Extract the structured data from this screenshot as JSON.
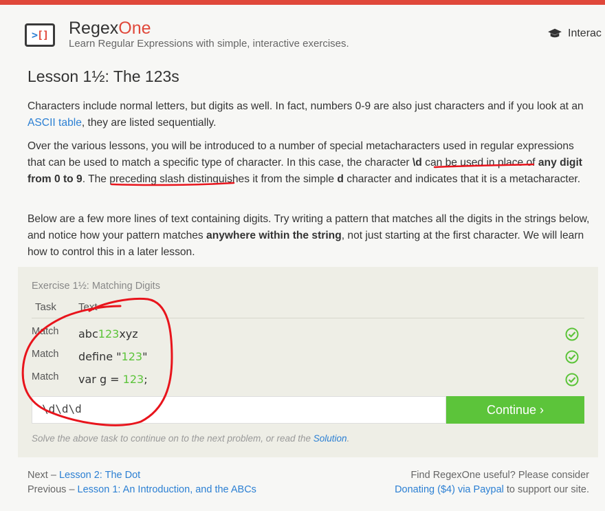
{
  "header": {
    "brand_a": "Regex",
    "brand_b": "One",
    "tagline": "Learn Regular Expressions with simple, interactive exercises.",
    "nav_label": "Interac"
  },
  "lesson": {
    "title": "Lesson 1½: The 123s",
    "p1": {
      "a": "Characters include normal letters, but digits as well. In fact, numbers 0-9 are also just characters and if you look at an ",
      "link": "ASCII table",
      "b": ", they are listed sequentially."
    },
    "p2": {
      "a": "Over the various lessons, you will be introduced to a number of special metacharacters used in regular expressions that can be used to match a specific type of character. In this case, the character ",
      "b1": "\\d",
      "c": " can be used in place of ",
      "b2": "any digit from 0 to 9",
      "d": ". The preceding slash distinguishes it from the simple ",
      "b3": "d",
      "e": " character and indicates that it is a metacharacter."
    },
    "p3": {
      "a": "Below are a few more lines of text containing digits. Try writing a pattern that matches all the digits in the strings below, and notice how your pattern matches ",
      "b": "anywhere within the string",
      "c": ", not just starting at the first character. We will learn how to control this in a later lesson."
    }
  },
  "exercise": {
    "title": "Exercise 1½: Matching Digits",
    "col_task": "Task",
    "col_text": "Text",
    "rows": [
      {
        "task": "Match",
        "pre": "abc",
        "hl": "123",
        "post": "xyz"
      },
      {
        "task": "Match",
        "pre": "define \"",
        "hl": "123",
        "post": "\""
      },
      {
        "task": "Match",
        "pre": "var g = ",
        "hl": "123",
        "post": ";"
      }
    ],
    "input_value": "\\d\\d\\d",
    "continue_label": "Continue ›",
    "hint_a": "Solve the above task to continue on to the next problem, or read the ",
    "hint_link": "Solution",
    "hint_b": "."
  },
  "footer": {
    "next_prefix": "Next – ",
    "next_link": "Lesson 2: The Dot",
    "prev_prefix": "Previous – ",
    "prev_link": "Lesson 1: An Introduction, and the ABCs",
    "right1": "Find RegexOne useful? Please consider",
    "right2_link": "Donating ($4) via Paypal",
    "right2_rest": " to support our site."
  },
  "colors": {
    "accent_red": "#e0483a",
    "link_blue": "#2b7fd3",
    "match_green": "#5cc43a",
    "annotation_red": "#e8141c"
  }
}
